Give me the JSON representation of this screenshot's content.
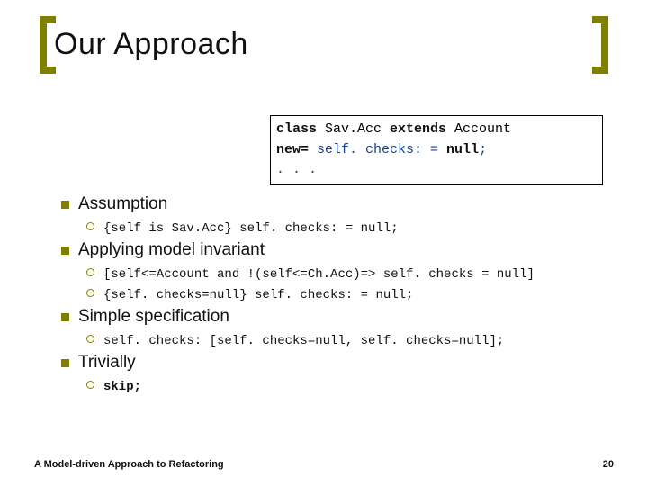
{
  "title": "Our Approach",
  "codebox": {
    "line1_kw": "class",
    "line1_rest": " Sav.Acc ",
    "line1_kw2": "extends",
    "line1_rest2": " Account",
    "line2_kw": "new=",
    "line2_rest": " self. checks: = ",
    "line2_kw2": "null",
    "line2_rest2": ";",
    "line3": ". . ."
  },
  "sections": [
    {
      "heading": "Assumption",
      "subs": [
        {
          "text": "{self is Sav.Acc} self. checks: = null;"
        }
      ]
    },
    {
      "heading": "Applying model invariant",
      "subs": [
        {
          "text": "[self<=Account and !(self<=Ch.Acc)=> self. checks = null]"
        },
        {
          "text": "{self. checks=null} self. checks: = null;"
        }
      ]
    },
    {
      "heading": "Simple specification",
      "subs": [
        {
          "text": "self. checks: [self. checks=null, self. checks=null];"
        }
      ]
    },
    {
      "heading": "Trivially",
      "subs": [
        {
          "text": "skip;",
          "bold": true
        }
      ]
    }
  ],
  "footer": {
    "left": "A Model-driven Approach to Refactoring",
    "right": "20"
  }
}
